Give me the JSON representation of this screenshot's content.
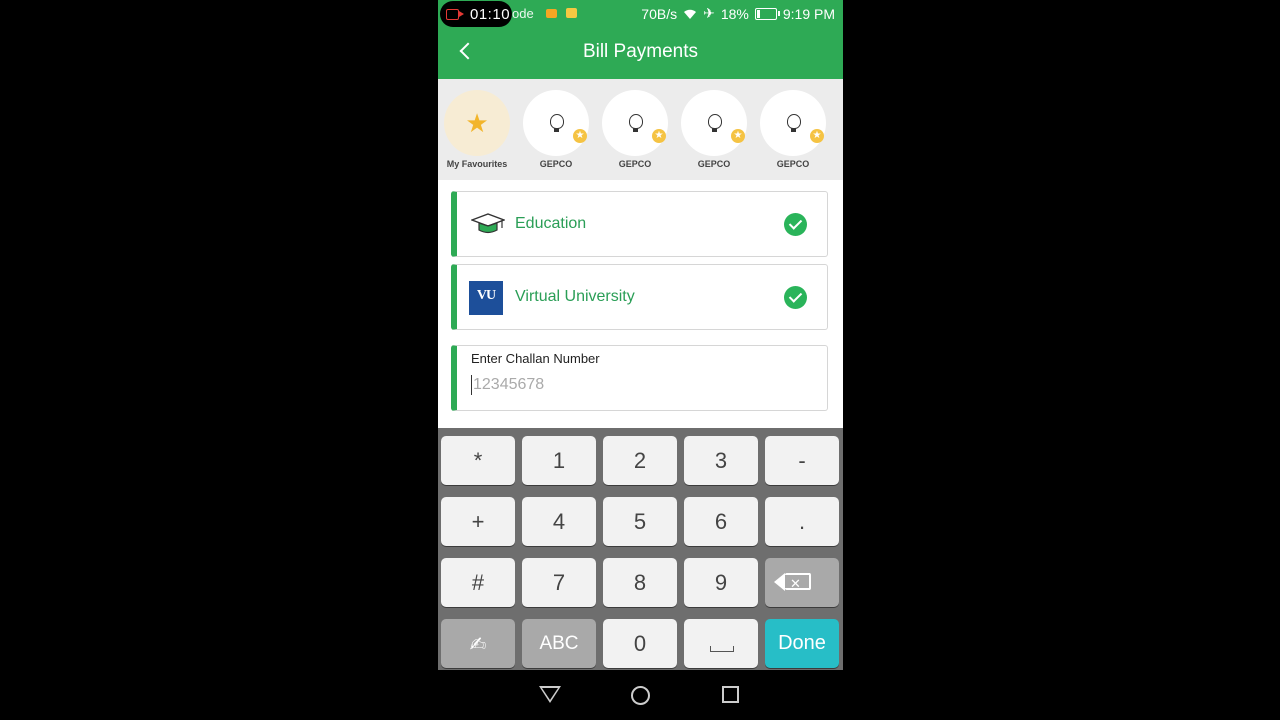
{
  "status_bar": {
    "recording_time": "01:10",
    "left_text": "ode",
    "speed": "70B/s",
    "battery": "18%",
    "battery_level": 0.18,
    "clock": "9:19 PM"
  },
  "header": {
    "title": "Bill Payments"
  },
  "favourites": [
    {
      "label": "My Favourites",
      "icon": "star-icon"
    },
    {
      "label": "GEPCO",
      "icon": "bulb-icon"
    },
    {
      "label": "GEPCO",
      "icon": "bulb-icon"
    },
    {
      "label": "GEPCO",
      "icon": "bulb-icon"
    },
    {
      "label": "GEPCO",
      "icon": "bulb-icon"
    }
  ],
  "selections": {
    "category": "Education",
    "biller": "Virtual University",
    "biller_logo_text": "VU"
  },
  "challan": {
    "label": "Enter Challan Number",
    "placeholder": "12345678",
    "value": ""
  },
  "keyboard": {
    "rows": [
      [
        "*",
        "1",
        "2",
        "3",
        "-"
      ],
      [
        "+",
        "4",
        "5",
        "6",
        "."
      ],
      [
        "#",
        "7",
        "8",
        "9",
        "backspace"
      ],
      [
        "handwriting",
        "ABC",
        "0",
        "space",
        "Done"
      ]
    ],
    "done_label": "Done",
    "abc_label": "ABC"
  },
  "colors": {
    "brand_green": "#2eaa55",
    "done_key": "#27bec7",
    "check": "#2ab45a"
  }
}
